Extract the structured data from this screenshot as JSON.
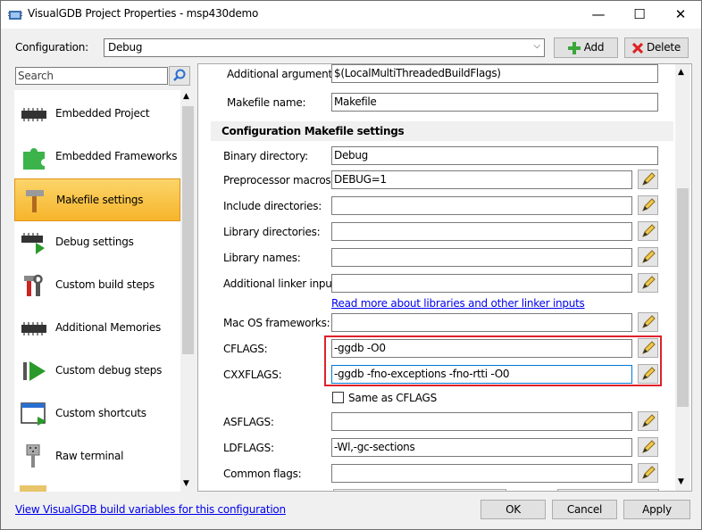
{
  "window": {
    "title": "VisualGDB Project Properties - msp430demo",
    "minimize_glyph": "—",
    "maximize_glyph": "☐",
    "close_glyph": "✕"
  },
  "config": {
    "label": "Configuration:",
    "value": "Debug",
    "add_label": "Add",
    "delete_label": "Delete"
  },
  "search": {
    "placeholder": "Search"
  },
  "sidebar": {
    "items": [
      {
        "label": "Embedded Project",
        "icon": "chip-icon",
        "selected": false
      },
      {
        "label": "Embedded Frameworks",
        "icon": "puzzle-icon",
        "selected": false
      },
      {
        "label": "Makefile settings",
        "icon": "hammer-icon",
        "selected": true
      },
      {
        "label": "Debug settings",
        "icon": "chip-play-icon",
        "selected": false
      },
      {
        "label": "Custom build steps",
        "icon": "tools-icon",
        "selected": false
      },
      {
        "label": "Additional Memories",
        "icon": "chip-icon",
        "selected": false
      },
      {
        "label": "Custom debug steps",
        "icon": "play-icon",
        "selected": false
      },
      {
        "label": "Custom shortcuts",
        "icon": "window-icon",
        "selected": false
      },
      {
        "label": "Raw terminal",
        "icon": "connector-icon",
        "selected": false
      }
    ]
  },
  "settings": {
    "additional_arguments": {
      "label": "Additional arguments:",
      "value": "$(LocalMultiThreadedBuildFlags)"
    },
    "makefile_name": {
      "label": "Makefile name:",
      "value": "Makefile"
    },
    "section_title": "Configuration Makefile settings",
    "binary_directory": {
      "label": "Binary directory:",
      "value": "Debug"
    },
    "preprocessor_macros": {
      "label": "Preprocessor macros:",
      "value": "DEBUG=1"
    },
    "include_directories": {
      "label": "Include directories:",
      "value": ""
    },
    "library_directories": {
      "label": "Library directories:",
      "value": ""
    },
    "library_names": {
      "label": "Library names:",
      "value": ""
    },
    "additional_linker_inputs": {
      "label": "Additional linker inputs:",
      "value": ""
    },
    "libraries_link": "Read more about libraries and other linker inputs",
    "mac_os_frameworks": {
      "label": "Mac OS frameworks:",
      "value": ""
    },
    "cflags": {
      "label": "CFLAGS:",
      "value": "-ggdb -O0"
    },
    "cxxflags": {
      "label": "CXXFLAGS:",
      "value": "-ggdb -fno-exceptions -fno-rtti -O0"
    },
    "same_as_cflags": {
      "label": "Same as CFLAGS",
      "checked": false
    },
    "asflags": {
      "label": "ASFLAGS:",
      "value": ""
    },
    "ldflags": {
      "label": "LDFLAGS:",
      "value": "-Wl,-gc-sections"
    },
    "common_flags": {
      "label": "Common flags:",
      "value": ""
    }
  },
  "footer": {
    "link": "View VisualGDB build variables for this configuration",
    "ok_label": "OK",
    "cancel_label": "Cancel",
    "apply_label": "Apply"
  },
  "colors": {
    "selection": "#f7b42b",
    "highlight_box": "#e0202a",
    "link": "#0000ee",
    "focus_border": "#0078d7"
  }
}
